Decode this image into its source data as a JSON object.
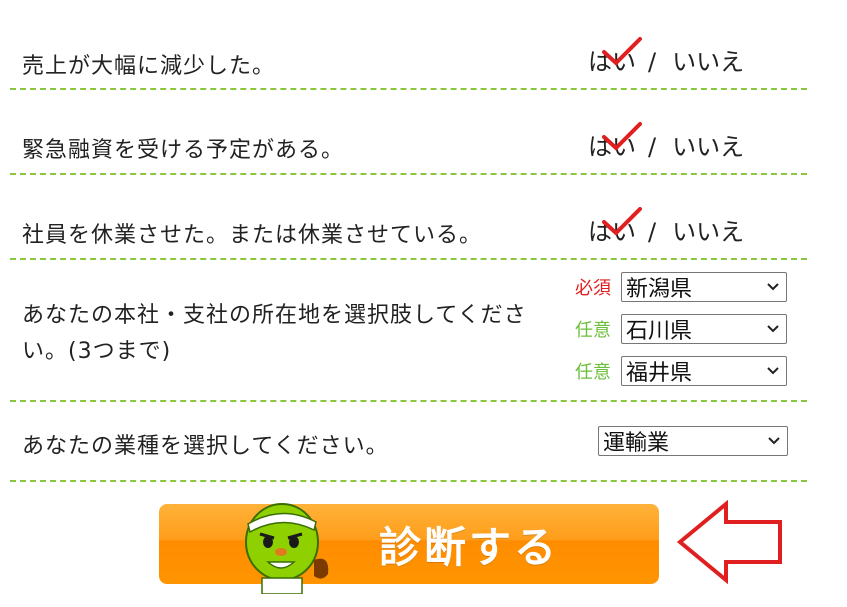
{
  "questions": [
    {
      "text": "売上が大幅に減少した。",
      "yes": "はい",
      "sep": "/",
      "no": "いいえ"
    },
    {
      "text": "緊急融資を受ける予定がある。",
      "yes": "はい",
      "sep": "/",
      "no": "いいえ"
    },
    {
      "text": "社員を休業させた。または休業させている。",
      "yes": "はい",
      "sep": "/",
      "no": "いいえ"
    }
  ],
  "location": {
    "question": "あなたの本社・支社の所在地を選択肢してください。(3つまで)",
    "selects": [
      {
        "tag": "必須",
        "value": "新潟県"
      },
      {
        "tag": "任意",
        "value": "石川県"
      },
      {
        "tag": "任意",
        "value": "福井県"
      }
    ]
  },
  "industry": {
    "question": "あなたの業種を選択してください。",
    "value": "運輸業"
  },
  "submit": {
    "label": "診断する"
  },
  "colors": {
    "accent": "#8cc63f",
    "button": "#ff9800",
    "required": "#e02020",
    "optional": "#6cbf3a",
    "arrow": "#e02020"
  },
  "icons": {
    "check": "red-check-icon",
    "dropdown": "chevron-down-icon",
    "mascot": "mascot-icon",
    "pointer": "red-arrow-icon"
  }
}
